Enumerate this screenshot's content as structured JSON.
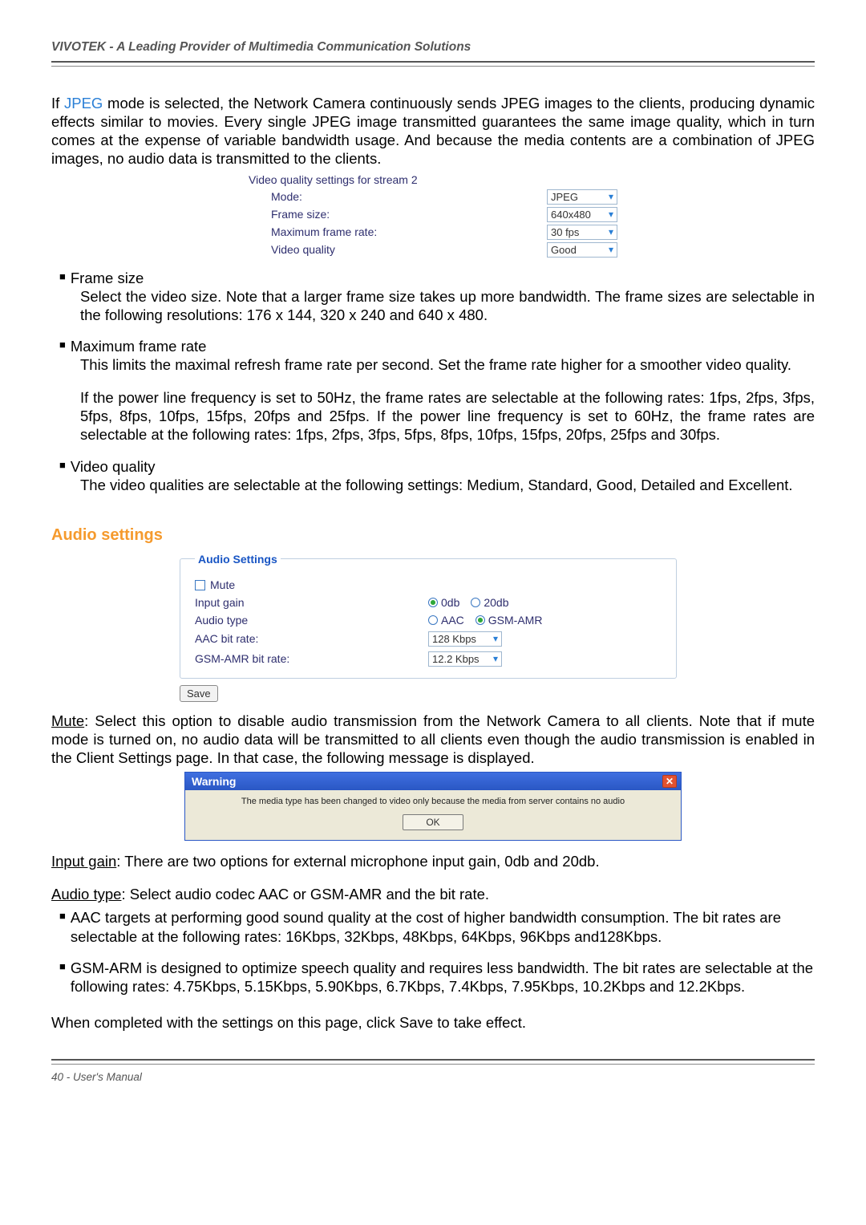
{
  "header": {
    "title": "VIVOTEK - A Leading Provider of Multimedia Communication Solutions"
  },
  "intro": {
    "prefix": "If ",
    "jpeg": "JPEG",
    "rest": " mode is selected, the Network Camera continuously sends JPEG images to the clients, producing dynamic effects similar to movies. Every single JPEG image transmitted guarantees the same image quality, which in turn comes at the expense of variable bandwidth usage. And because the media contents are a combination of JPEG images, no audio data is transmitted to the clients."
  },
  "video_settings": {
    "title": "Video quality settings for stream 2",
    "rows": [
      {
        "label": "Mode:",
        "value": "JPEG"
      },
      {
        "label": "Frame size:",
        "value": "640x480"
      },
      {
        "label": "Maximum frame rate:",
        "value": "30 fps"
      },
      {
        "label": "Video quality",
        "value": "Good"
      }
    ]
  },
  "frame_size": {
    "heading": "Frame size",
    "body": "Select the video size. Note that a larger frame size takes up more bandwidth. The frame sizes are selectable in the following resolutions: 176 x 144, 320 x 240 and 640 x 480."
  },
  "max_frame_rate": {
    "heading": "Maximum frame rate",
    "body1": "This limits the maximal refresh frame rate per second. Set the frame rate higher for a smoother video quality.",
    "body2": "If the power line frequency is set to 50Hz, the frame rates are selectable at the following rates: 1fps, 2fps, 3fps, 5fps, 8fps, 10fps, 15fps, 20fps and 25fps. If the power line frequency is set to 60Hz, the frame rates are selectable at the following rates: 1fps, 2fps, 3fps, 5fps, 8fps, 10fps, 15fps, 20fps, 25fps and 30fps."
  },
  "video_quality": {
    "heading": "Video quality",
    "body": "The video qualities are selectable at the following settings: Medium, Standard, Good, Detailed and Excellent."
  },
  "audio_section_heading": "Audio settings",
  "audio_panel": {
    "legend": "Audio Settings",
    "mute_label": "Mute",
    "rows": {
      "input_gain_label": "Input gain",
      "input_gain_opts": {
        "a": "0db",
        "b": "20db",
        "selected": "a"
      },
      "audio_type_label": "Audio type",
      "audio_type_opts": {
        "a": "AAC",
        "b": "GSM-AMR",
        "selected": "b"
      },
      "aac_label": "AAC bit rate:",
      "aac_value": "128 Kbps",
      "gsm_label": "GSM-AMR bit rate:",
      "gsm_value": "12.2 Kbps"
    },
    "save": "Save"
  },
  "mute_para": {
    "label": "Mute",
    "body": ": Select this option to disable audio transmission from the Network Camera to all clients. Note that if mute mode is turned on, no audio data will be transmitted to all clients even though the audio transmission is enabled in the Client Settings page. In that case, the following message is displayed."
  },
  "warning": {
    "title": "Warning",
    "body": "The media type has been changed to video only because the media from server contains no audio",
    "ok": "OK"
  },
  "input_gain_para": {
    "label": "Input gain",
    "body": ": There are two options for external microphone input gain, 0db and 20db."
  },
  "audio_type_para": {
    "label": "Audio type",
    "body": ": Select audio codec AAC or GSM-AMR and the bit rate."
  },
  "aac_bullet": "AAC targets at performing good sound quality at the cost of higher bandwidth consumption. The bit rates are selectable at the following rates: 16Kbps, 32Kbps, 48Kbps, 64Kbps, 96Kbps and128Kbps.",
  "gsm_bullet": "GSM-ARM is designed to optimize speech quality and requires less bandwidth. The bit rates are selectable at the following rates: 4.75Kbps, 5.15Kbps, 5.90Kbps, 6.7Kbps, 7.4Kbps, 7.95Kbps, 10.2Kbps and 12.2Kbps.",
  "closing": "When completed with the settings on this page, click Save to take effect.",
  "footer": "40 - User's Manual"
}
